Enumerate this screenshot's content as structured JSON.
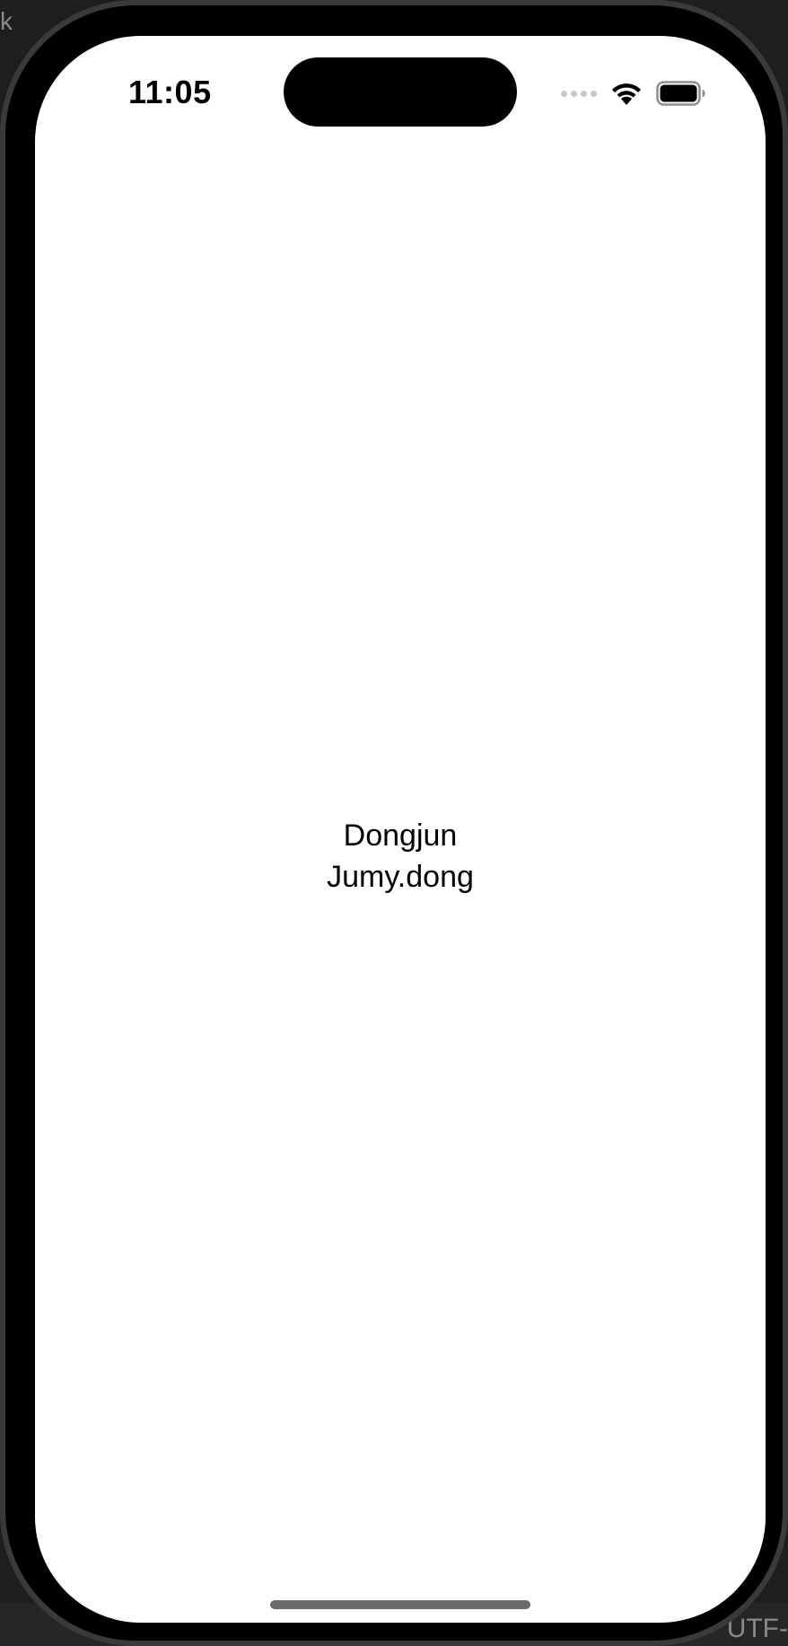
{
  "host": {
    "top_fragment": "k",
    "bottom_fragment": "UTF-"
  },
  "status_bar": {
    "time": "11:05",
    "icons": [
      "signal-dots-icon",
      "wifi-icon",
      "battery-icon"
    ]
  },
  "content": {
    "line1": "Dongjun",
    "line2": "Jumy.dong"
  },
  "colors": {
    "screen_background": "#ffffff",
    "text": "#000000",
    "frame": "#000000"
  }
}
